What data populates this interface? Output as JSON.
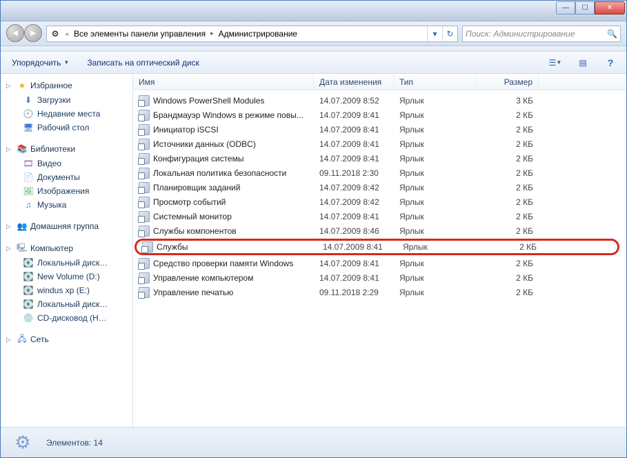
{
  "window": {
    "minimize_tooltip": "Свернуть",
    "maximize_tooltip": "Развернуть",
    "close_tooltip": "Закрыть"
  },
  "address": {
    "prefix": "«",
    "seg1": "Все элементы панели управления",
    "seg2": "Администрирование"
  },
  "search": {
    "placeholder": "Поиск: Администрирование"
  },
  "toolbar": {
    "organize": "Упорядочить",
    "burn": "Записать на оптический диск"
  },
  "navpane": {
    "favorites": {
      "label": "Избранное",
      "items": [
        "Загрузки",
        "Недавние места",
        "Рабочий стол"
      ]
    },
    "libraries": {
      "label": "Библиотеки",
      "items": [
        "Видео",
        "Документы",
        "Изображения",
        "Музыка"
      ]
    },
    "homegroup": {
      "label": "Домашняя группа"
    },
    "computer": {
      "label": "Компьютер",
      "items": [
        "Локальный диск…",
        "New Volume (D:)",
        "windus xp (E:)",
        "Локальный диск…",
        "CD-дисковод (H…"
      ]
    },
    "network": {
      "label": "Сеть"
    }
  },
  "columns": {
    "name": "Имя",
    "date": "Дата изменения",
    "type": "Тип",
    "size": "Размер"
  },
  "files": [
    {
      "name": "Windows PowerShell Modules",
      "date": "14.07.2009 8:52",
      "type": "Ярлык",
      "size": "3 КБ"
    },
    {
      "name": "Брандмауэр Windows в режиме повы...",
      "date": "14.07.2009 8:41",
      "type": "Ярлык",
      "size": "2 КБ"
    },
    {
      "name": "Инициатор iSCSI",
      "date": "14.07.2009 8:41",
      "type": "Ярлык",
      "size": "2 КБ"
    },
    {
      "name": "Источники данных (ODBC)",
      "date": "14.07.2009 8:41",
      "type": "Ярлык",
      "size": "2 КБ"
    },
    {
      "name": "Конфигурация системы",
      "date": "14.07.2009 8:41",
      "type": "Ярлык",
      "size": "2 КБ"
    },
    {
      "name": "Локальная политика безопасности",
      "date": "09.11.2018 2:30",
      "type": "Ярлык",
      "size": "2 КБ"
    },
    {
      "name": "Планировщик заданий",
      "date": "14.07.2009 8:42",
      "type": "Ярлык",
      "size": "2 КБ"
    },
    {
      "name": "Просмотр событий",
      "date": "14.07.2009 8:42",
      "type": "Ярлык",
      "size": "2 КБ"
    },
    {
      "name": "Системный монитор",
      "date": "14.07.2009 8:41",
      "type": "Ярлык",
      "size": "2 КБ"
    },
    {
      "name": "Службы компонентов",
      "date": "14.07.2009 8:46",
      "type": "Ярлык",
      "size": "2 КБ"
    },
    {
      "name": "Службы",
      "date": "14.07.2009 8:41",
      "type": "Ярлык",
      "size": "2 КБ",
      "highlight": true
    },
    {
      "name": "Средство проверки памяти Windows",
      "date": "14.07.2009 8:41",
      "type": "Ярлык",
      "size": "2 КБ"
    },
    {
      "name": "Управление компьютером",
      "date": "14.07.2009 8:41",
      "type": "Ярлык",
      "size": "2 КБ"
    },
    {
      "name": "Управление печатью",
      "date": "09.11.2018 2:29",
      "type": "Ярлык",
      "size": "2 КБ"
    }
  ],
  "status": {
    "text": "Элементов: 14"
  }
}
